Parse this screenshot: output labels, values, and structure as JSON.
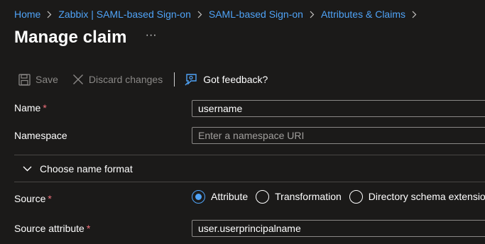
{
  "breadcrumb": [
    {
      "label": "Home"
    },
    {
      "label": "Zabbix | SAML-based Sign-on"
    },
    {
      "label": "SAML-based Sign-on"
    },
    {
      "label": "Attributes & Claims"
    }
  ],
  "page": {
    "title": "Manage claim",
    "more": "···"
  },
  "toolbar": {
    "save_label": "Save",
    "discard_label": "Discard changes",
    "feedback_label": "Got feedback?"
  },
  "form": {
    "name": {
      "label": "Name",
      "required": "*",
      "value": "username"
    },
    "namespace": {
      "label": "Namespace",
      "value": "",
      "placeholder": "Enter a namespace URI"
    },
    "name_format": {
      "label": "Choose name format"
    },
    "source": {
      "label": "Source",
      "required": "*",
      "options": [
        "Attribute",
        "Transformation",
        "Directory schema extension"
      ],
      "selected": "Attribute"
    },
    "source_attribute": {
      "label": "Source attribute",
      "required": "*",
      "value": "user.userprincipalname"
    }
  },
  "colors": {
    "accent": "#4fa3f7",
    "required": "#f1707b",
    "background": "#1b1a19"
  }
}
